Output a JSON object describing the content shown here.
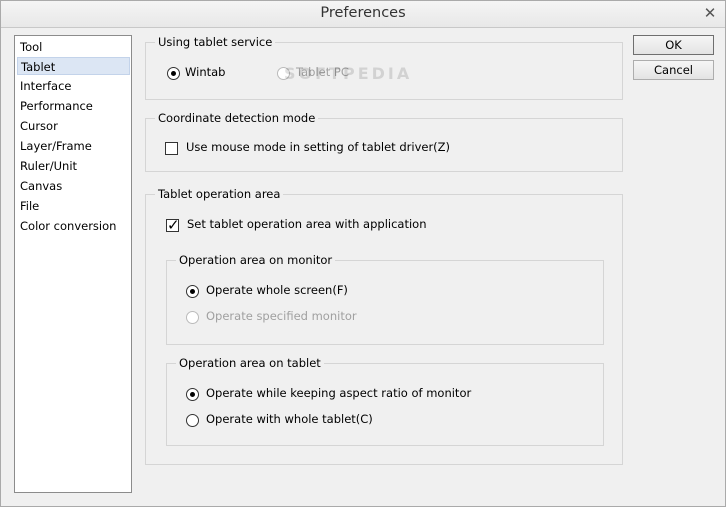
{
  "window": {
    "title": "Preferences"
  },
  "sidebar": {
    "items": [
      {
        "label": "Tool",
        "selected": false
      },
      {
        "label": "Tablet",
        "selected": true
      },
      {
        "label": "Interface",
        "selected": false
      },
      {
        "label": "Performance",
        "selected": false
      },
      {
        "label": "Cursor",
        "selected": false
      },
      {
        "label": "Layer/Frame",
        "selected": false
      },
      {
        "label": "Ruler/Unit",
        "selected": false
      },
      {
        "label": "Canvas",
        "selected": false
      },
      {
        "label": "File",
        "selected": false
      },
      {
        "label": "Color conversion",
        "selected": false
      }
    ]
  },
  "buttons": {
    "ok": "OK",
    "cancel": "Cancel"
  },
  "tablet_service": {
    "legend": "Using tablet service",
    "wintab": "Wintab",
    "tablet_pc": "Tablet PC",
    "selected": "wintab"
  },
  "coordinate": {
    "legend": "Coordinate detection mode",
    "mouse_mode": "Use mouse mode in setting of tablet driver(Z)",
    "mouse_mode_checked": false
  },
  "operation_area": {
    "legend": "Tablet operation area",
    "set_with_app": "Set tablet operation area with application",
    "set_with_app_checked": true,
    "monitor": {
      "legend": "Operation area on monitor",
      "whole_screen": "Operate whole screen(F)",
      "specified_monitor": "Operate specified monitor",
      "selected": "whole_screen"
    },
    "tablet": {
      "legend": "Operation area on tablet",
      "keep_aspect": "Operate while keeping aspect ratio of monitor",
      "whole_tablet": "Operate with whole tablet(C)",
      "selected": "keep_aspect"
    }
  },
  "watermark": "SOFTPEDIA"
}
